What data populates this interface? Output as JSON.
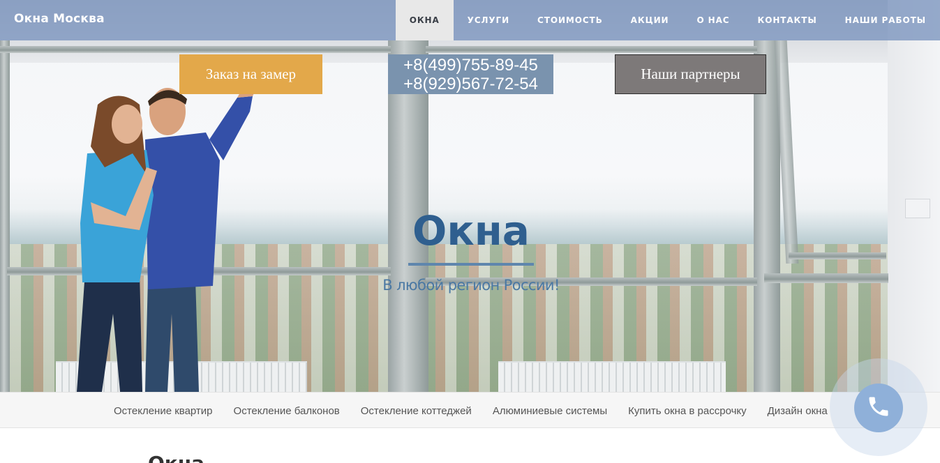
{
  "navbar": {
    "brand": "Окна Москва",
    "items": [
      {
        "label": "ОКНА",
        "active": true
      },
      {
        "label": "УСЛУГИ",
        "active": false
      },
      {
        "label": "СТОИМОСТЬ",
        "active": false
      },
      {
        "label": "АКЦИИ",
        "active": false
      },
      {
        "label": "О НАС",
        "active": false
      },
      {
        "label": "КОНТАКТЫ",
        "active": false
      },
      {
        "label": "НАШИ РАБОТЫ",
        "active": false
      }
    ]
  },
  "hero": {
    "order_button": "Заказ на замер",
    "phones": [
      "+8(499)755-89-45",
      "+8(929)567-72-54"
    ],
    "partners_button": "Наши партнеры",
    "title": "Окна",
    "subtitle": "В любой регион России!"
  },
  "subnav": {
    "items": [
      "Остекление квартир",
      "Остекление балконов",
      "Остекление коттеджей",
      "Алюминиевые системы",
      "Купить окна в рассрочку",
      "Дизайн окна"
    ]
  },
  "content": {
    "title": "Окна"
  },
  "colors": {
    "navbar_bg": "#7a94be",
    "order_button": "#e3a84a",
    "phones_bg": "#7a93ae",
    "partners_button": "#7d7979",
    "hero_title": "#2f5f8f",
    "call_button": "#8fb0d9"
  },
  "icons": {
    "call": "phone-icon"
  }
}
